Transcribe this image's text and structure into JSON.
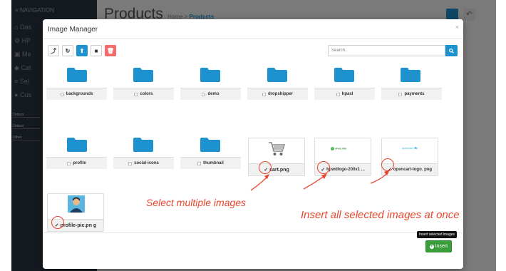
{
  "background": {
    "nav_header": "≡ NAVIGATION",
    "nav_items": [
      "Das",
      "HP",
      "Me",
      "Cat",
      "Sal",
      "Cus"
    ],
    "mini_labels": [
      "Orders",
      "Orders",
      "Other"
    ],
    "page_title": "Products",
    "crumb_home": "Home",
    "crumb_sep": ">",
    "crumb_current": "Products"
  },
  "modal": {
    "title": "Image Manager",
    "close": "×",
    "toolbar": {
      "parent_label": "⤴",
      "refresh_label": "↻",
      "upload_label": "⬆",
      "folder_label": "■",
      "delete_label": "🗑"
    },
    "search_placeholder": "Search..",
    "folders": [
      "backgrounds",
      "colors",
      "demo",
      "dropshipper",
      "hpasl",
      "payments",
      "profile",
      "social-icons",
      "thumbnail"
    ],
    "images": [
      {
        "name": "cart.png",
        "checked": true
      },
      {
        "name": "hpwdlogo-200x1 ...",
        "checked": true
      },
      {
        "name": "opencart-logo. png",
        "checked": true
      },
      {
        "name": "profile-pic.pn g",
        "checked": true
      }
    ],
    "image_captions": {
      "hpwd": "HPWD.PRO",
      "opencart": "opencart"
    },
    "insert_label": "Insert",
    "insert_tooltip": "Insert selected images"
  },
  "annotations": {
    "select_multiple": "Select multiple images",
    "insert_all": "Insert all selected images at once"
  },
  "colors": {
    "primary": "#1e91cf",
    "danger": "#f56b6b",
    "success": "#3b9e3b",
    "annotation": "#e8452c",
    "sidebar": "#2a3440"
  }
}
